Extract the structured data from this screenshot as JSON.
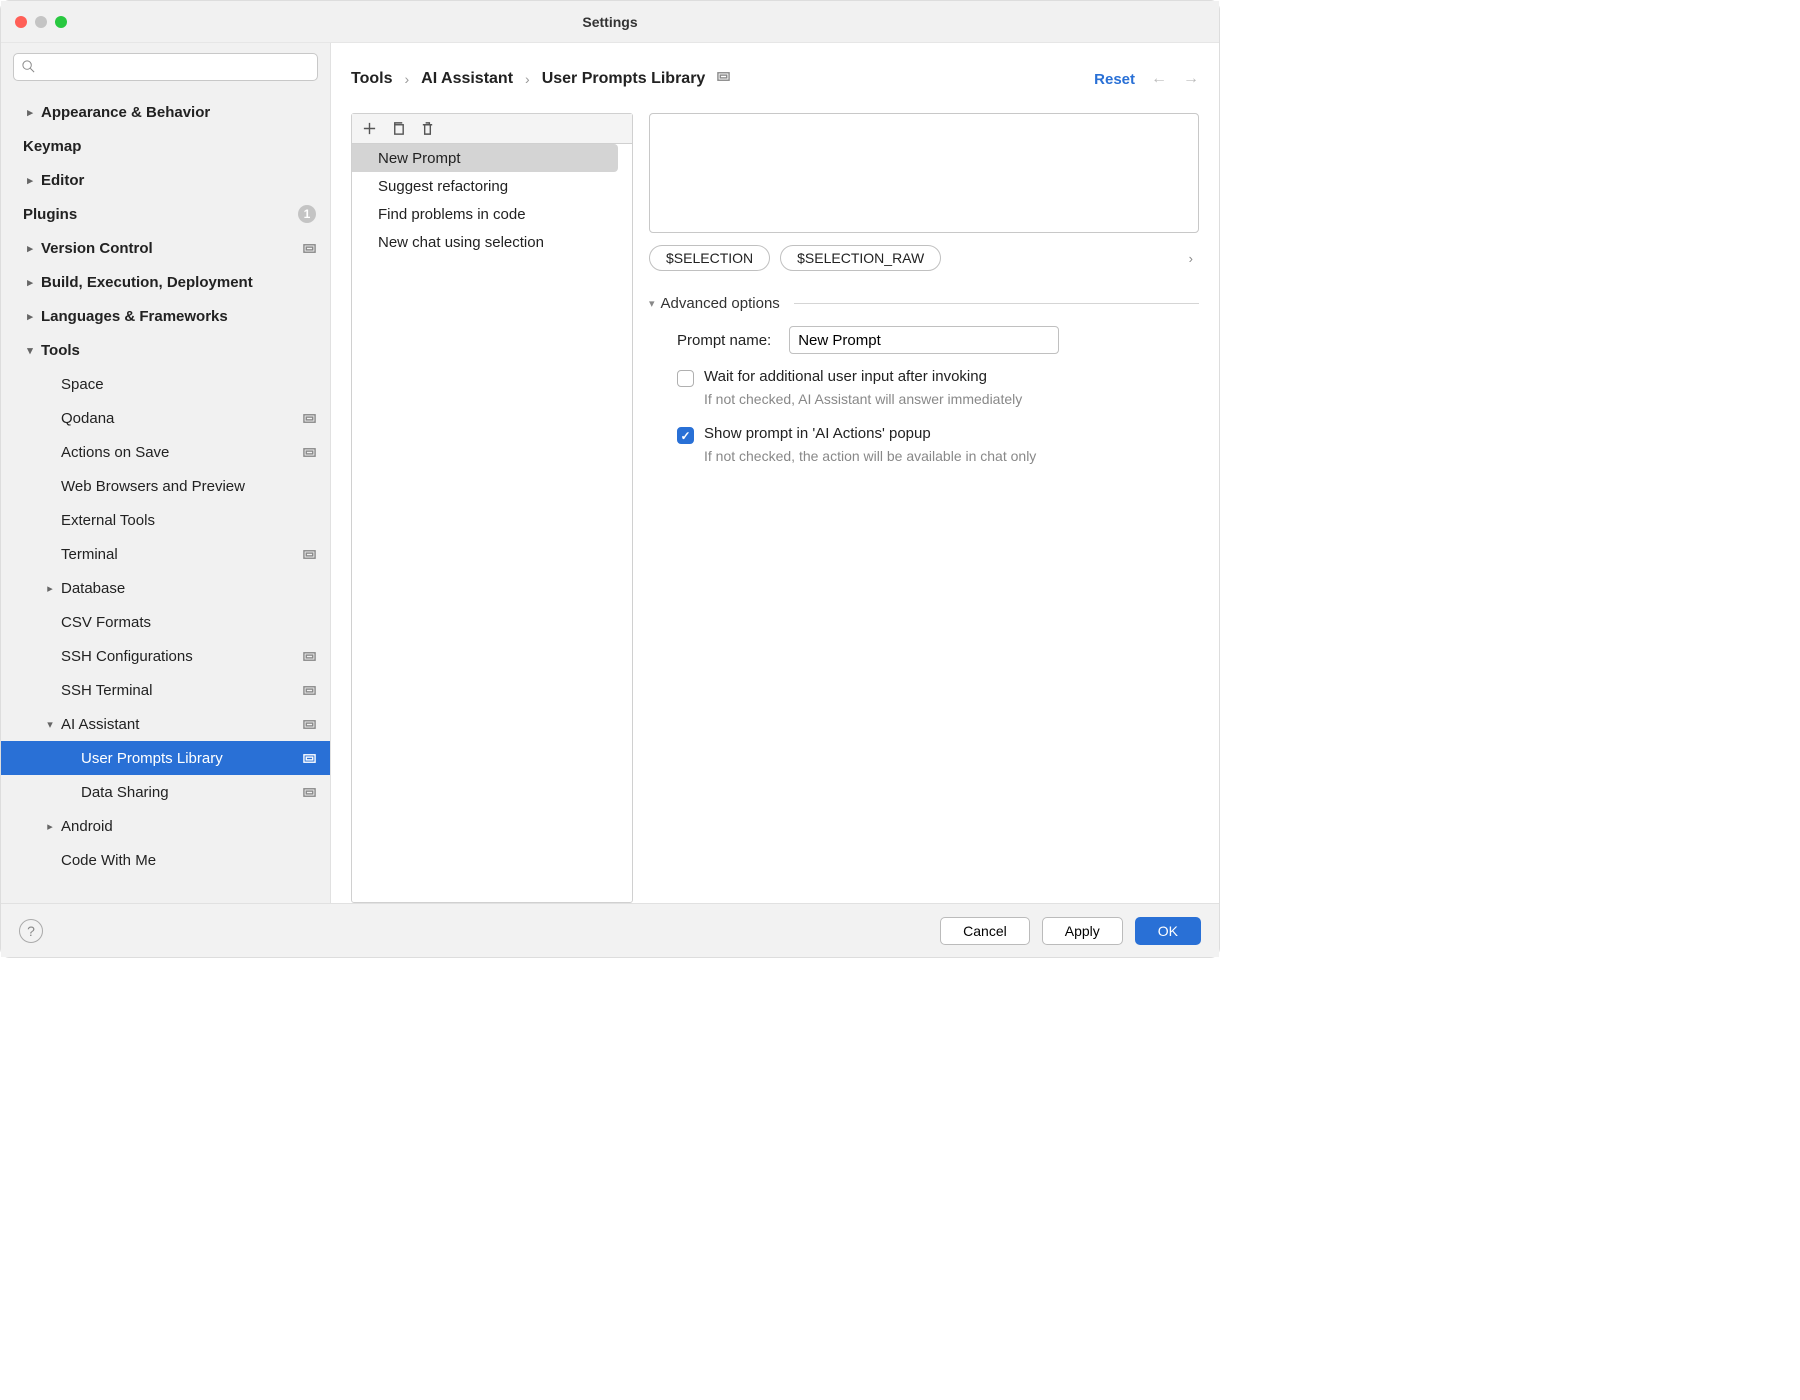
{
  "window": {
    "title": "Settings"
  },
  "sidebar": {
    "items": [
      {
        "label": "Appearance & Behavior",
        "top": true,
        "chev": "right"
      },
      {
        "label": "Keymap",
        "top": true
      },
      {
        "label": "Editor",
        "top": true,
        "chev": "right"
      },
      {
        "label": "Plugins",
        "top": true,
        "badge": "1"
      },
      {
        "label": "Version Control",
        "top": true,
        "chev": "right",
        "sq": true
      },
      {
        "label": "Build, Execution, Deployment",
        "top": true,
        "chev": "right"
      },
      {
        "label": "Languages & Frameworks",
        "top": true,
        "chev": "right"
      },
      {
        "label": "Tools",
        "top": true,
        "chev": "down"
      },
      {
        "label": "Space",
        "level": 1
      },
      {
        "label": "Qodana",
        "level": 1,
        "sq": true
      },
      {
        "label": "Actions on Save",
        "level": 1,
        "sq": true
      },
      {
        "label": "Web Browsers and Preview",
        "level": 1
      },
      {
        "label": "External Tools",
        "level": 1
      },
      {
        "label": "Terminal",
        "level": 1,
        "sq": true
      },
      {
        "label": "Database",
        "level": 1,
        "chev": "right"
      },
      {
        "label": "CSV Formats",
        "level": 1
      },
      {
        "label": "SSH Configurations",
        "level": 1,
        "sq": true
      },
      {
        "label": "SSH Terminal",
        "level": 1,
        "sq": true
      },
      {
        "label": "AI Assistant",
        "level": 1,
        "chev": "down",
        "sq": true
      },
      {
        "label": "User Prompts Library",
        "level": 2,
        "sq": true,
        "selected": true
      },
      {
        "label": "Data Sharing",
        "level": 2,
        "sq": true
      },
      {
        "label": "Android",
        "level": 1,
        "chev": "right"
      },
      {
        "label": "Code With Me",
        "level": 1
      }
    ]
  },
  "breadcrumb": {
    "a": "Tools",
    "b": "AI Assistant",
    "c": "User Prompts Library"
  },
  "header": {
    "reset": "Reset"
  },
  "prompts": {
    "items": [
      {
        "label": "New Prompt",
        "selected": true
      },
      {
        "label": "Suggest refactoring"
      },
      {
        "label": "Find problems in code"
      },
      {
        "label": "New chat using selection"
      }
    ]
  },
  "chips": {
    "a": "$SELECTION",
    "b": "$SELECTION_RAW"
  },
  "advanced": {
    "title": "Advanced options",
    "prompt_name_label": "Prompt name:",
    "prompt_name_value": "New Prompt",
    "wait_label": "Wait for additional user input after invoking",
    "wait_hint": "If not checked, AI Assistant will answer immediately",
    "show_label": "Show prompt in 'AI Actions' popup",
    "show_hint": "If not checked, the action will be available in chat only"
  },
  "footer": {
    "cancel": "Cancel",
    "apply": "Apply",
    "ok": "OK"
  }
}
